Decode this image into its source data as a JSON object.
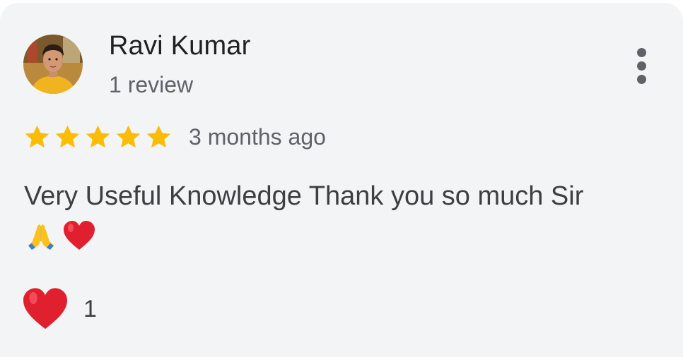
{
  "review": {
    "reviewer_name": "Ravi Kumar",
    "review_count": "1 review",
    "rating": 5,
    "rating_max": 5,
    "date": "3 months ago",
    "text": "Very Useful Knowledge Thank you so much Sir",
    "text_emojis": [
      "folded-hands-emoji",
      "red-heart-emoji"
    ]
  },
  "reaction": {
    "icon": "red-heart-icon",
    "count": "1"
  },
  "menu": {
    "icon": "more-vert-icon"
  },
  "colors": {
    "card_background": "#f3f4f6",
    "star": "#fbbc04",
    "heart": "#e0202f",
    "primary_text": "#202124",
    "secondary_text": "#5f6368"
  }
}
